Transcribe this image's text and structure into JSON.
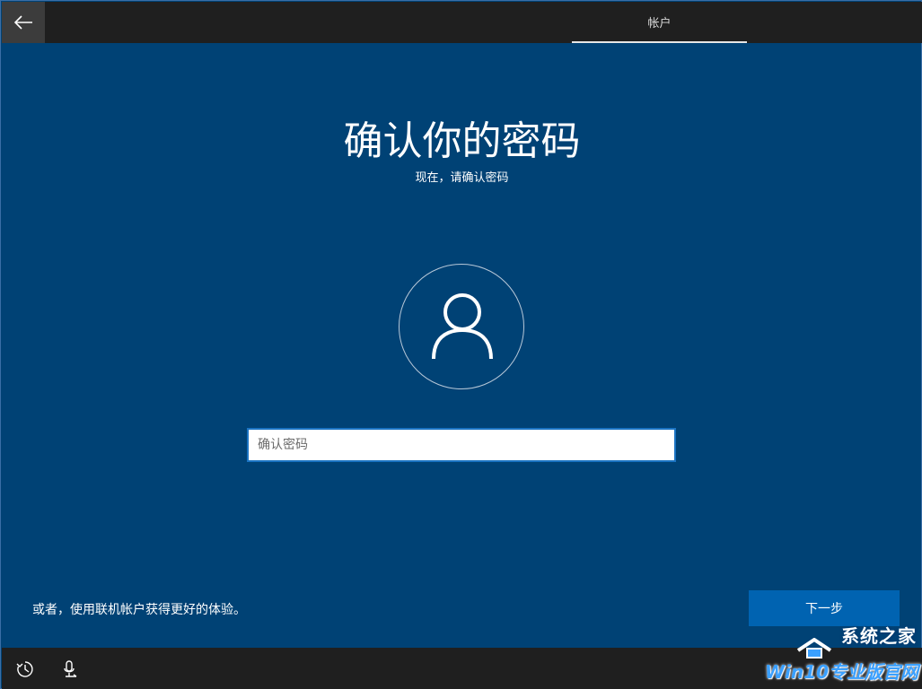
{
  "topbar": {
    "back_icon": "arrow-left-icon",
    "tab_label": "帐户"
  },
  "main": {
    "title": "确认你的密码",
    "subtitle": "现在，请确认密码",
    "avatar_icon": "user-icon",
    "password_placeholder": "确认密码",
    "password_value": ""
  },
  "footer": {
    "alt_link": "或者，使用联机帐户获得更好的体验。",
    "next_label": "下一步"
  },
  "bottombar": {
    "ease_icon": "ease-of-access-icon",
    "mic_icon": "microphone-icon"
  },
  "watermark": {
    "line1": "系统之家",
    "line2": "Win10专业版官网"
  },
  "colors": {
    "background": "#004275",
    "bar": "#1f1f1f",
    "accent": "#0063b1",
    "input_border": "#1a73c2"
  }
}
